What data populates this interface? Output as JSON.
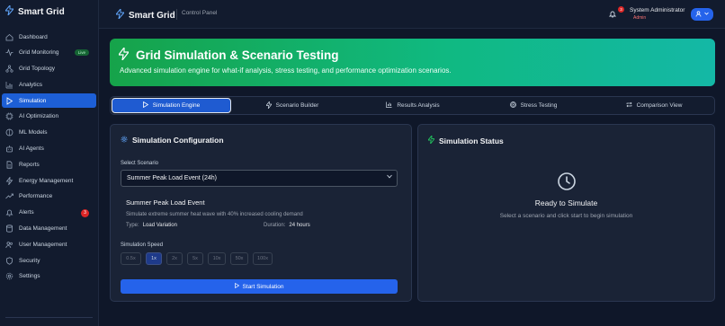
{
  "sidebar": {
    "brand": "Smart Grid",
    "items": [
      {
        "label": "Dashboard",
        "icon": "home-icon"
      },
      {
        "label": "Grid Monitoring",
        "icon": "activity-icon",
        "badge": "Live"
      },
      {
        "label": "Grid Topology",
        "icon": "network-icon"
      },
      {
        "label": "Analytics",
        "icon": "chart-icon"
      },
      {
        "label": "Simulation",
        "icon": "play-icon",
        "active": true
      },
      {
        "label": "AI Optimization",
        "icon": "cpu-icon"
      },
      {
        "label": "ML Models",
        "icon": "brain-icon"
      },
      {
        "label": "AI Agents",
        "icon": "bot-icon"
      },
      {
        "label": "Reports",
        "icon": "file-icon"
      },
      {
        "label": "Energy Management",
        "icon": "bolt-icon"
      },
      {
        "label": "Performance",
        "icon": "trend-icon"
      },
      {
        "label": "Alerts",
        "icon": "bell-icon",
        "count": "3"
      },
      {
        "label": "Data Management",
        "icon": "database-icon"
      },
      {
        "label": "User Management",
        "icon": "users-icon"
      },
      {
        "label": "Security",
        "icon": "shield-icon"
      },
      {
        "label": "Settings",
        "icon": "gear-icon"
      }
    ]
  },
  "header": {
    "brand": "Smart Grid",
    "subtitle": "Control Panel",
    "notification_count": "3",
    "user_name": "System Administrator",
    "user_role": "Admin"
  },
  "hero": {
    "title": "Grid Simulation & Scenario Testing",
    "description": "Advanced simulation engine for what-if analysis, stress testing, and performance optimization scenarios."
  },
  "tabs": [
    {
      "label": "Simulation Engine",
      "icon": "play-icon",
      "active": true
    },
    {
      "label": "Scenario Builder",
      "icon": "bolt-icon"
    },
    {
      "label": "Results Analysis",
      "icon": "bar-chart-icon"
    },
    {
      "label": "Stress Testing",
      "icon": "target-icon"
    },
    {
      "label": "Comparison View",
      "icon": "repeat-icon"
    }
  ],
  "config": {
    "title": "Simulation Configuration",
    "select_label": "Select Scenario",
    "selected_scenario": "Summer Peak Load Event (24h)",
    "scenario_name": "Summer Peak Load Event",
    "scenario_description": "Simulate extreme summer heat wave with 40% increased cooling demand",
    "type_label": "Type:",
    "type_value": "Load Variation",
    "duration_label": "Duration:",
    "duration_value": "24 hours",
    "speed_label": "Simulation Speed",
    "speeds": [
      "0.5x",
      "1x",
      "2x",
      "5x",
      "10x",
      "50x",
      "100x"
    ],
    "active_speed": "1x",
    "start_label": "Start Simulation"
  },
  "status": {
    "title": "Simulation Status",
    "ready_title": "Ready to Simulate",
    "ready_subtitle": "Select a scenario and click start to begin simulation"
  },
  "colors": {
    "accent": "#2563eb",
    "hero_start": "#16a34a",
    "hero_end": "#14b8a6",
    "background": "#0f1729",
    "alert": "#dc2626"
  }
}
